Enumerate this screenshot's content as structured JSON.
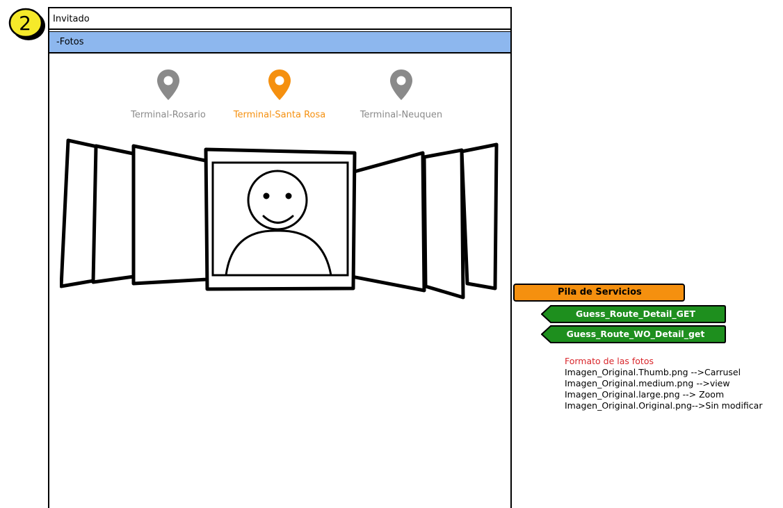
{
  "badge": {
    "number": "2",
    "color": "#f5e92a"
  },
  "header": {
    "user": "Invitado"
  },
  "tab": {
    "label": "-Fotos",
    "color": "#8db7ee"
  },
  "terminals": [
    {
      "label": "Terminal-Rosario",
      "icon": "map-pin-icon",
      "active": false,
      "color": "#8a8a8a"
    },
    {
      "label": "Terminal-Santa Rosa",
      "icon": "map-pin-icon",
      "active": true,
      "color": "#f5900f"
    },
    {
      "label": "Terminal-Neuquen",
      "icon": "map-pin-icon",
      "active": false,
      "color": "#8a8a8a"
    }
  ],
  "carousel": {
    "center_image_icon": "user-avatar-icon"
  },
  "services": {
    "title": "Pila de Servicios",
    "title_color": "#f5900f",
    "item_color": "#1e8f1e",
    "items": [
      {
        "label": "Guess_Route_Detail_GET"
      },
      {
        "label": "Guess_Route_WO_Detail_get"
      }
    ]
  },
  "formats": {
    "title": "Formato de las fotos",
    "title_color": "#d9262b",
    "lines": [
      "Imagen_Original.Thumb.png -->Carrusel",
      "Imagen_Original.medium.png -->view",
      "Imagen_Original.large.png --> Zoom",
      "Imagen_Original.Original.png-->Sin modificar"
    ]
  }
}
